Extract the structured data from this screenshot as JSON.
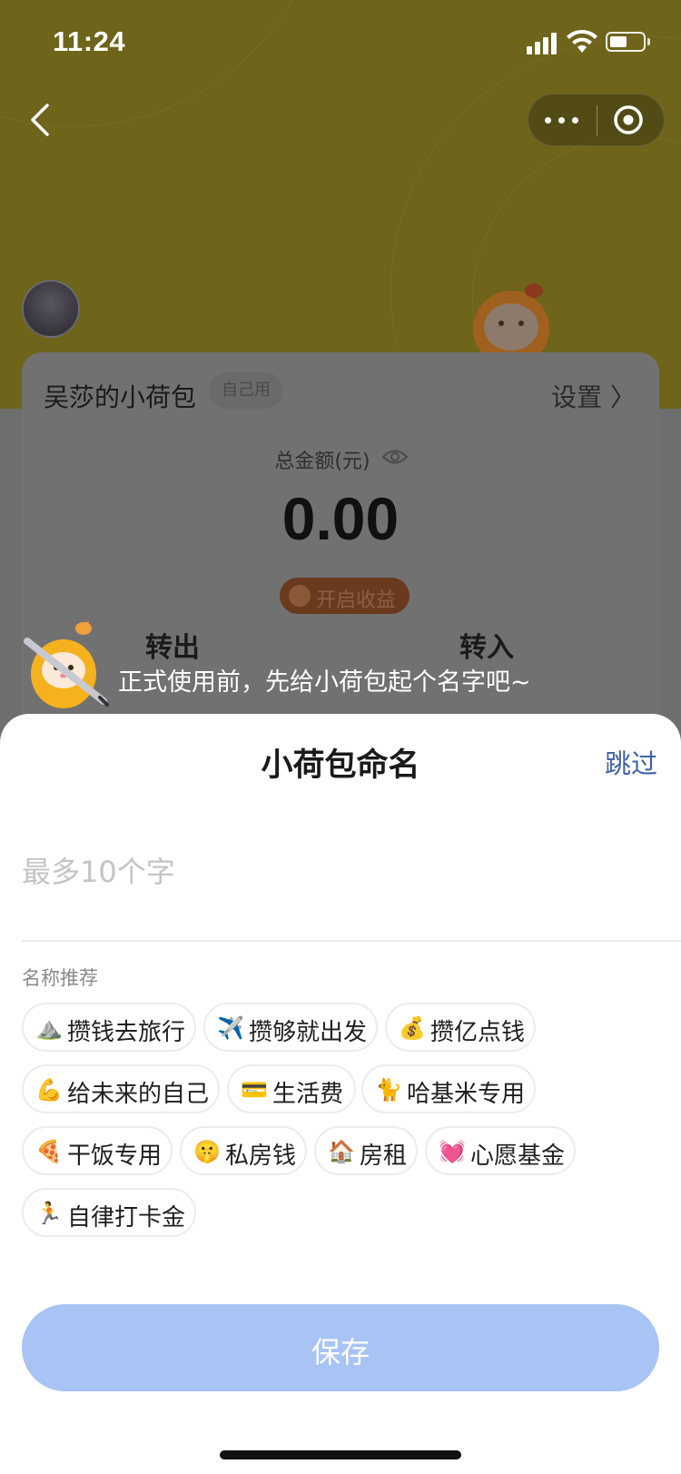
{
  "status_bar": {
    "time": "11:24"
  },
  "wallet": {
    "name": "吴莎的小荷包",
    "tag": "自己用",
    "settings_label": "设置 〉",
    "total_label": "总金额(元)",
    "total_amount": "0.00",
    "earn_label": "开启收益",
    "transfer_out_label": "转出",
    "transfer_in_label": "转入"
  },
  "prompt": {
    "text": "正式使用前，先给小荷包起个名字吧~"
  },
  "sheet": {
    "title": "小荷包命名",
    "skip_label": "跳过",
    "input_placeholder": "最多10个字",
    "recommend_label": "名称推荐",
    "save_label": "保存",
    "suggestions": [
      {
        "emoji": "⛰️",
        "label": "攒钱去旅行"
      },
      {
        "emoji": "✈️",
        "label": "攒够就出发"
      },
      {
        "emoji": "💰",
        "label": "攒亿点钱"
      },
      {
        "emoji": "💪",
        "label": "给未来的自己"
      },
      {
        "emoji": "💳",
        "label": "生活费"
      },
      {
        "emoji": "🐈",
        "label": "哈基米专用"
      },
      {
        "emoji": "🍕",
        "label": "干饭专用"
      },
      {
        "emoji": "🤫",
        "label": "私房钱"
      },
      {
        "emoji": "🏠",
        "label": "房租"
      },
      {
        "emoji": "💓",
        "label": "心愿基金"
      },
      {
        "emoji": "🏃",
        "label": "自律打卡金"
      }
    ]
  },
  "colors": {
    "header_bg": "#6e641a",
    "overlay_bg": "#6e6e6e",
    "link_blue": "#3d63a6",
    "save_disabled": "#a8c4f5"
  }
}
